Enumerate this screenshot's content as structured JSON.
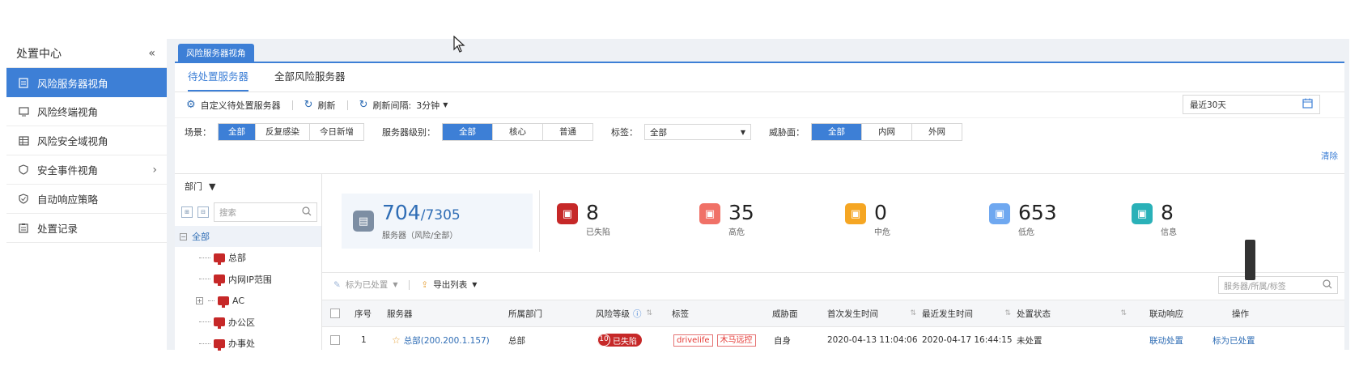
{
  "sidebar": {
    "title": "处置中心",
    "collapse": "«",
    "items": [
      {
        "label": "风险服务器视角",
        "icon": "server-icon"
      },
      {
        "label": "风险终端视角",
        "icon": "monitor-icon"
      },
      {
        "label": "风险安全域视角",
        "icon": "grid-icon"
      },
      {
        "label": "安全事件视角",
        "icon": "shield-icon",
        "arrow": "›"
      },
      {
        "label": "自动响应策略",
        "icon": "check-shield-icon"
      },
      {
        "label": "处置记录",
        "icon": "clipboard-icon"
      }
    ]
  },
  "main_tab": "风险服务器视角",
  "subtabs": [
    "待处置服务器",
    "全部风险服务器"
  ],
  "toolbar": {
    "custom": "自定义待处置服务器",
    "refresh": "刷新",
    "interval_label": "刷新间隔:",
    "interval_value": "3分钟"
  },
  "date_range": "最近30天",
  "filters": {
    "scene_label": "场景：",
    "scene_options": [
      "全部",
      "反复感染",
      "今日新增"
    ],
    "level_label": "服务器级别：",
    "level_options": [
      "全部",
      "核心",
      "普通"
    ],
    "tag_label": "标签：",
    "tag_value": "全部",
    "threat_label": "威胁面：",
    "threat_options": [
      "全部",
      "内网",
      "外网"
    ],
    "clear": "清除"
  },
  "tree": {
    "header": "部门",
    "search_placeholder": "搜索",
    "root": "全部",
    "nodes": [
      "总部",
      "内网IP范围",
      "AC",
      "办公区",
      "办事处"
    ]
  },
  "stats": {
    "main_value": "704",
    "main_total": "/7305",
    "main_label": "服务器（风险/全部）",
    "items": [
      {
        "value": "8",
        "label": "已失陷",
        "color": "#c62828"
      },
      {
        "value": "35",
        "label": "高危",
        "color": "#f07167"
      },
      {
        "value": "0",
        "label": "中危",
        "color": "#f5a623"
      },
      {
        "value": "653",
        "label": "低危",
        "color": "#6fa8f0"
      },
      {
        "value": "8",
        "label": "信息",
        "color": "#2ab1b8"
      }
    ]
  },
  "list_tools": {
    "mark": "标为已处置",
    "export": "导出列表",
    "search_placeholder": "服务器/所属/标签"
  },
  "table": {
    "headers": [
      "序号",
      "服务器",
      "所属部门",
      "风险等级",
      "标签",
      "威胁面",
      "首次发生时间",
      "最近发生时间",
      "处置状态",
      "联动响应",
      "操作"
    ],
    "rows": [
      {
        "index": "1",
        "server": "总部(200.200.1.157)",
        "dept": "总部",
        "risk_num": "10",
        "risk_label": "已失陷",
        "tags": [
          "drivelife",
          "木马远控"
        ],
        "threat": "自身",
        "first": "2020-04-13 11:04:06",
        "last": "2020-04-17 16:44:15",
        "status": "未处置",
        "link_action": "联动处置",
        "op": "标为已处置"
      }
    ]
  }
}
